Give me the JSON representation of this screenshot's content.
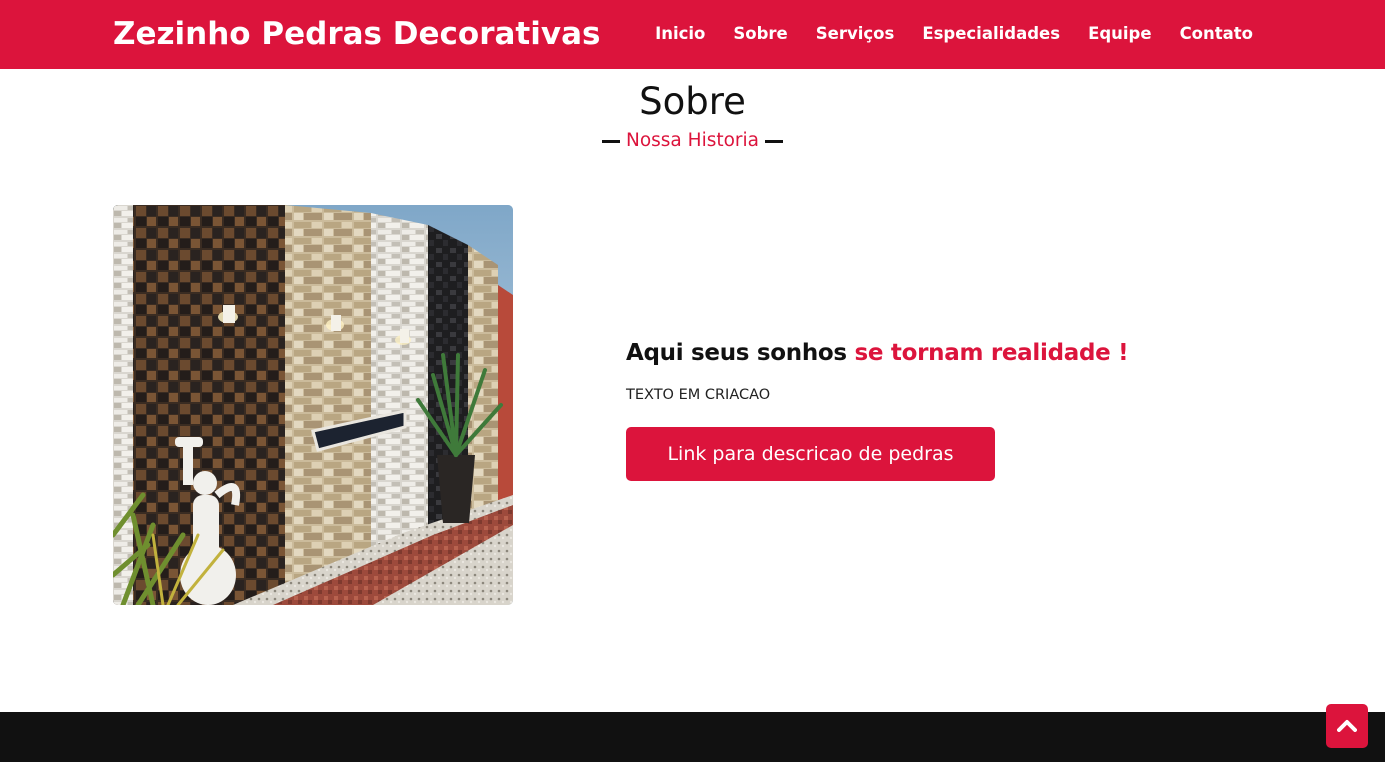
{
  "header": {
    "brand": "Zezinho Pedras Decorativas",
    "nav": [
      {
        "label": "Inicio"
      },
      {
        "label": "Sobre"
      },
      {
        "label": "Serviços"
      },
      {
        "label": "Especialidades"
      },
      {
        "label": "Equipe"
      },
      {
        "label": "Contato"
      }
    ]
  },
  "about": {
    "title": "Sobre",
    "subtitle": "Nossa Historia",
    "headline_part1": "Aqui seus sonhos ",
    "headline_accent": "se tornam realidade !",
    "body": "TEXTO EM CRIACAO",
    "button_label": "Link para descricao de pedras",
    "image_alt": "Parede decorada com pedras"
  },
  "icons": {
    "back_to_top": "chevron-up-icon"
  },
  "colors": {
    "primary": "#dc143c",
    "footer": "#111111",
    "text": "#111111",
    "background": "#ffffff"
  }
}
